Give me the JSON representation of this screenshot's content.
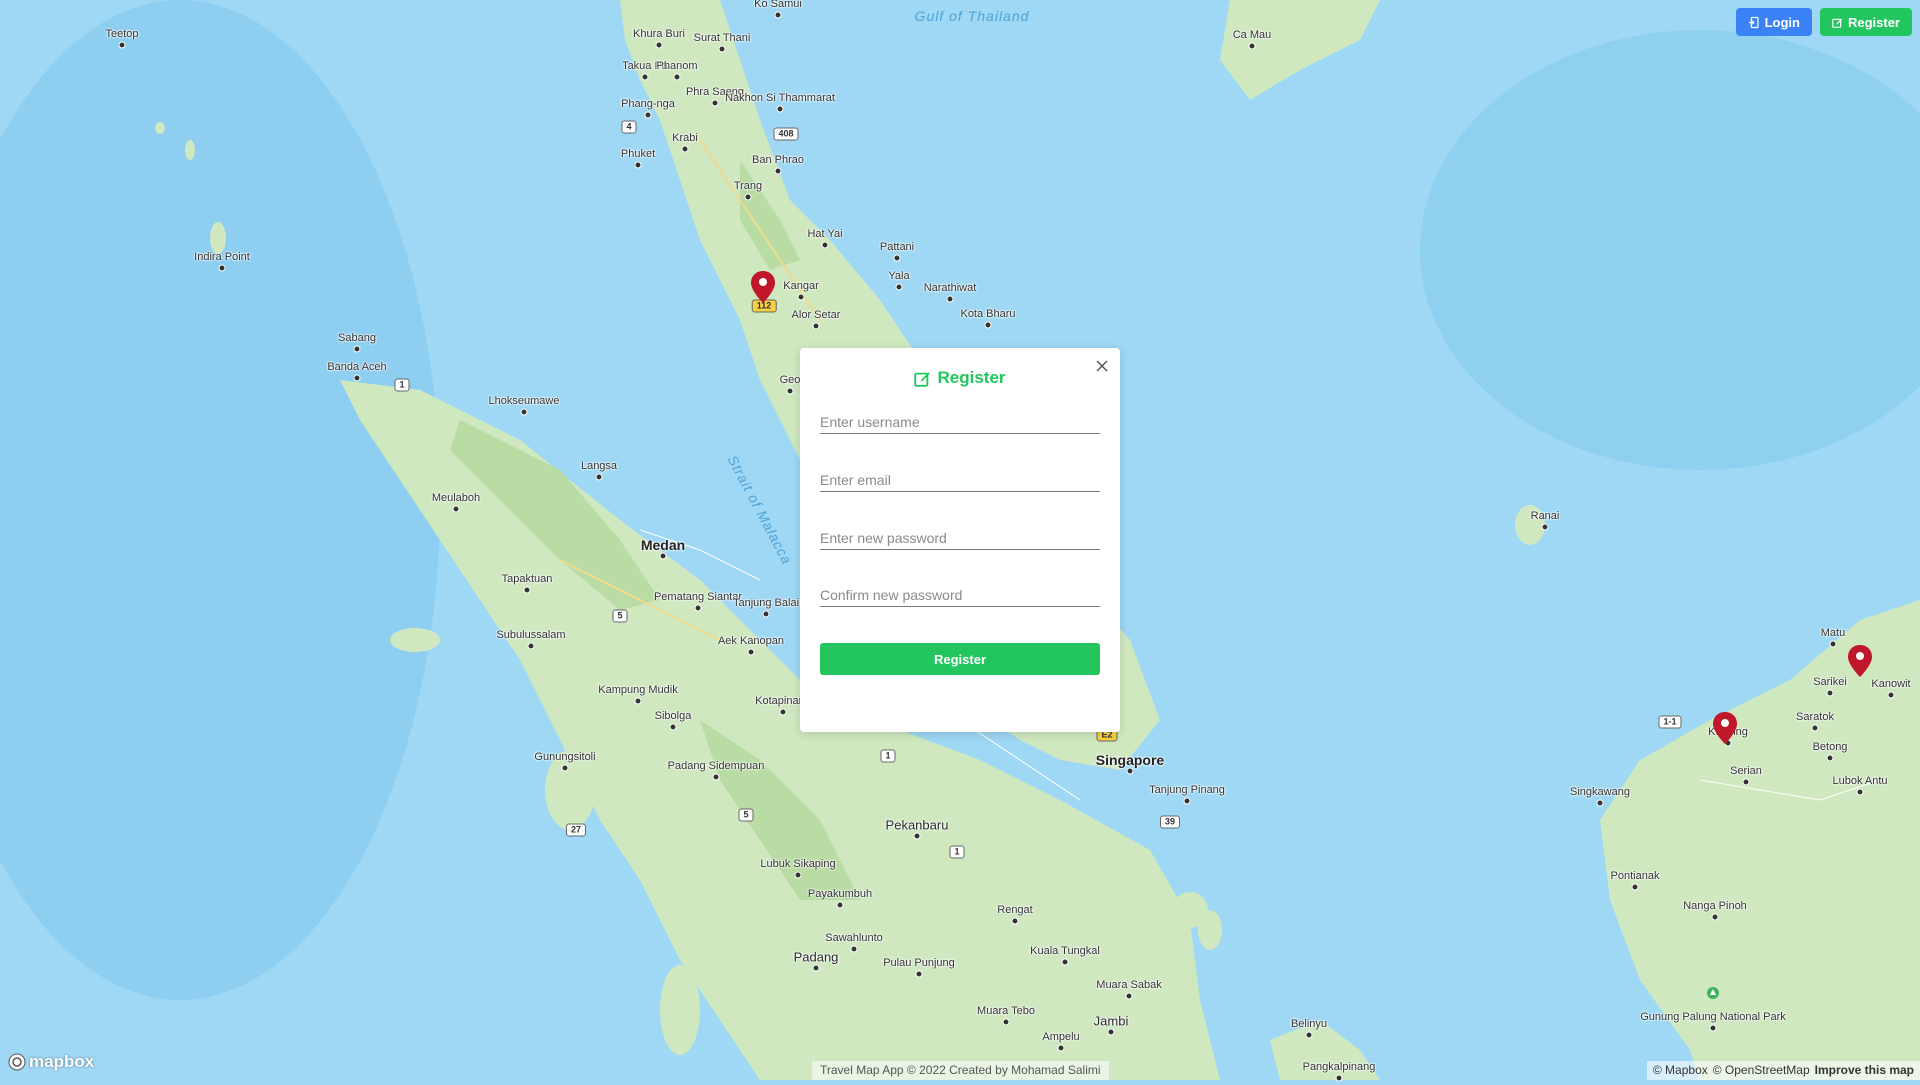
{
  "header": {
    "login_label": "Login",
    "register_label": "Register"
  },
  "modal": {
    "title": "Register",
    "username_placeholder": "Enter username",
    "email_placeholder": "Enter email",
    "password_placeholder": "Enter new password",
    "confirm_placeholder": "Confirm new password",
    "submit_label": "Register"
  },
  "map": {
    "places": [
      {
        "name": "Teetop",
        "cls": ""
      },
      {
        "name": "Surat Thani",
        "cls": ""
      },
      {
        "name": "Takua Pa",
        "cls": ""
      },
      {
        "name": "Phanom",
        "cls": ""
      },
      {
        "name": "Phra Saeng",
        "cls": ""
      },
      {
        "name": "Nakhon Si Thammarat",
        "cls": ""
      },
      {
        "name": "Phang-nga",
        "cls": ""
      },
      {
        "name": "Krabi",
        "cls": ""
      },
      {
        "name": "Phuket",
        "cls": ""
      },
      {
        "name": "Ban Phrao",
        "cls": ""
      },
      {
        "name": "Trang",
        "cls": ""
      },
      {
        "name": "Hat Yai",
        "cls": ""
      },
      {
        "name": "Pattani",
        "cls": ""
      },
      {
        "name": "Yala",
        "cls": ""
      },
      {
        "name": "Narathiwat",
        "cls": ""
      },
      {
        "name": "Kota Bharu",
        "cls": ""
      },
      {
        "name": "Kangar",
        "cls": ""
      },
      {
        "name": "Alor Setar",
        "cls": ""
      },
      {
        "name": "Indira Point",
        "cls": ""
      },
      {
        "name": "Sabang",
        "cls": ""
      },
      {
        "name": "Banda Aceh",
        "cls": ""
      },
      {
        "name": "Lhokseumawe",
        "cls": ""
      },
      {
        "name": "Langsa",
        "cls": ""
      },
      {
        "name": "Meulaboh",
        "cls": ""
      },
      {
        "name": "Medan",
        "cls": "big"
      },
      {
        "name": "Pematang Siantar",
        "cls": ""
      },
      {
        "name": "Tanjung Balai",
        "cls": ""
      },
      {
        "name": "Tapaktuan",
        "cls": ""
      },
      {
        "name": "Subulussalam",
        "cls": ""
      },
      {
        "name": "Aek Kanopan",
        "cls": ""
      },
      {
        "name": "Kampung Mudik",
        "cls": ""
      },
      {
        "name": "Sibolga",
        "cls": ""
      },
      {
        "name": "Kotapinang",
        "cls": ""
      },
      {
        "name": "Padang Sidempuan",
        "cls": ""
      },
      {
        "name": "Gunungsitoli",
        "cls": ""
      },
      {
        "name": "Pekanbaru",
        "cls": "med"
      },
      {
        "name": "Lubuk Sikaping",
        "cls": ""
      },
      {
        "name": "Payakumbuh",
        "cls": ""
      },
      {
        "name": "Sawahlunto",
        "cls": ""
      },
      {
        "name": "Padang",
        "cls": "med"
      },
      {
        "name": "Pulau Punjung",
        "cls": ""
      },
      {
        "name": "Rengat",
        "cls": ""
      },
      {
        "name": "Kuala Tungkal",
        "cls": ""
      },
      {
        "name": "Muara Sabak",
        "cls": ""
      },
      {
        "name": "Muara Tebo",
        "cls": ""
      },
      {
        "name": "Jambi",
        "cls": "med"
      },
      {
        "name": "Ampelu",
        "cls": ""
      },
      {
        "name": "Belinyu",
        "cls": ""
      },
      {
        "name": "Pangkalpinang",
        "cls": ""
      },
      {
        "name": "Singapore",
        "cls": "big"
      },
      {
        "name": "Tanjung Pinang",
        "cls": ""
      },
      {
        "name": "Ca Mau",
        "cls": ""
      },
      {
        "name": "Ranai",
        "cls": ""
      },
      {
        "name": "Matu",
        "cls": ""
      },
      {
        "name": "Sarikei",
        "cls": ""
      },
      {
        "name": "Kanowit",
        "cls": ""
      },
      {
        "name": "Saratok",
        "cls": ""
      },
      {
        "name": "Kuching",
        "cls": ""
      },
      {
        "name": "Betong",
        "cls": ""
      },
      {
        "name": "Serian",
        "cls": ""
      },
      {
        "name": "Lubok Antu",
        "cls": ""
      },
      {
        "name": "Singkawang",
        "cls": ""
      },
      {
        "name": "Pontianak",
        "cls": ""
      },
      {
        "name": "Nanga Pinoh",
        "cls": ""
      },
      {
        "name": "Gunung Palung National Park",
        "cls": ""
      },
      {
        "name": "Ko Samui",
        "cls": ""
      },
      {
        "name": "Khura Buri",
        "cls": ""
      },
      {
        "name": "Geo",
        "cls": ""
      }
    ],
    "sea_labels": [
      "Gulf of Thailand",
      "Strait of Malacca"
    ],
    "road_shields": [
      "4",
      "408",
      "112",
      "1",
      "5",
      "1",
      "5",
      "27",
      "1",
      "39",
      "E2",
      "1-1"
    ]
  },
  "footer": {
    "mapbox_logo": "mapbox",
    "credit": "Travel Map App © 2022 Created by Mohamad Salimi",
    "attribution_mapbox": "© Mapbox",
    "attribution_osm": "© OpenStreetMap",
    "attribution_improve": "Improve this map"
  },
  "colors": {
    "login": "#3a82f6",
    "register": "#22c55e",
    "pin": "#c0182a",
    "water": "#9ed8f5",
    "land": "#cfe8c0"
  }
}
